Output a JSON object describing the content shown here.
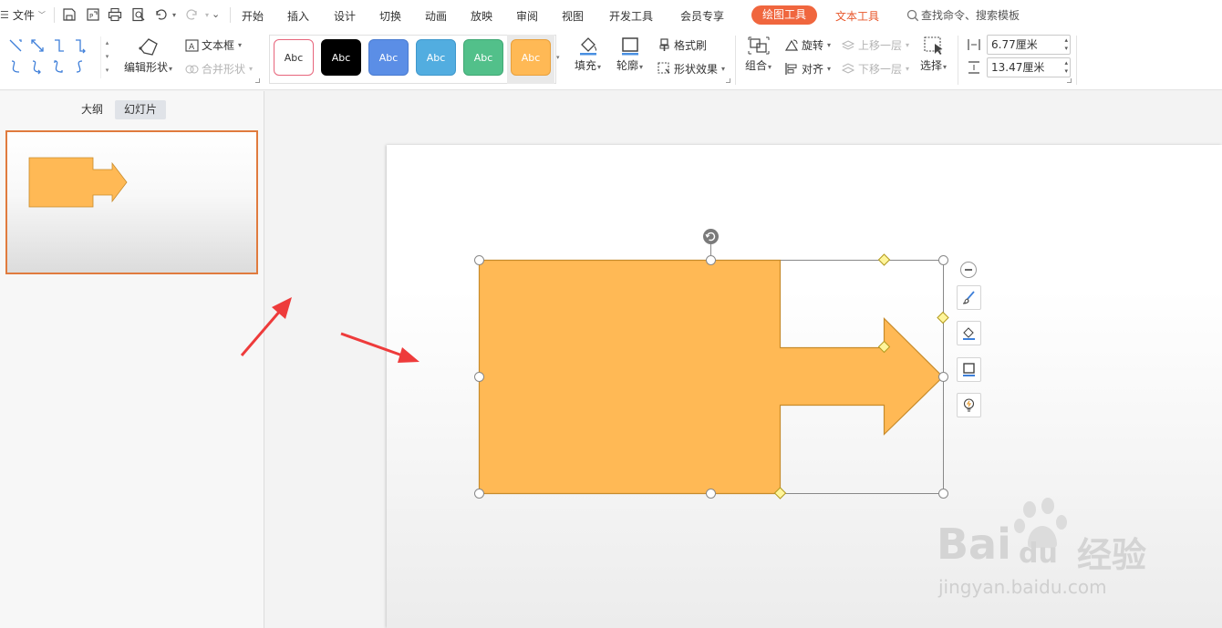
{
  "colors": {
    "accent": "#f0663e",
    "shape_fill": "#ffb955",
    "shape_stroke": "#c78b2b",
    "thumb_border": "#e07b3e",
    "arrow_red": "#ee3b3b"
  },
  "quick_access": {
    "file_label": "文件",
    "icons": [
      "menu-icon",
      "save-icon",
      "export-pdf-icon",
      "print-icon",
      "print-preview-icon",
      "undo-icon",
      "redo-icon",
      "customize-icon"
    ]
  },
  "menu_tabs": [
    "开始",
    "插入",
    "设计",
    "切换",
    "动画",
    "放映",
    "审阅",
    "视图",
    "开发工具",
    "会员专享"
  ],
  "context_tabs": {
    "drawing_tools": "绘图工具",
    "text_tools": "文本工具"
  },
  "search": {
    "label": "查找命令、搜索模板"
  },
  "ribbon": {
    "edit_shape": "编辑形状",
    "text_box": "文本框",
    "merge_shapes": "合并形状",
    "style_label": "Abc",
    "styles": [
      {
        "name": "outline-red",
        "bg": "#ffffff",
        "fg": "#333333",
        "border": "#e7657b"
      },
      {
        "name": "black",
        "bg": "#000000",
        "fg": "#ffffff",
        "border": "#000000"
      },
      {
        "name": "blue",
        "bg": "#5b8ee6",
        "fg": "#ffffff",
        "border": "#4a7bd0"
      },
      {
        "name": "light-blue",
        "bg": "#52ade0",
        "fg": "#ffffff",
        "border": "#3f98cc"
      },
      {
        "name": "green",
        "bg": "#52c08a",
        "fg": "#ffffff",
        "border": "#40a874"
      },
      {
        "name": "orange",
        "bg": "#ffb955",
        "fg": "#ffffff",
        "border": "#e8a03c"
      }
    ],
    "selected_style": 5,
    "fill": "填充",
    "outline": "轮廓",
    "format_painter": "格式刷",
    "shape_effects": "形状效果",
    "group": "组合",
    "rotate": "旋转",
    "align": "对齐",
    "bring_forward": "上移一层",
    "send_backward": "下移一层",
    "select": "选择",
    "height_value": "6.77厘米",
    "width_value": "13.47厘米"
  },
  "left_panel": {
    "tab_outline": "大纲",
    "tab_slides": "幻灯片"
  },
  "floating_tools": [
    "collapse-icon",
    "brush-icon",
    "fill-bucket-icon",
    "outline-icon",
    "bulb-icon"
  ],
  "watermark": {
    "brand": "Bai",
    "brand_tail": "du",
    "cn": "经验",
    "url": "jingyan.baidu.com"
  }
}
